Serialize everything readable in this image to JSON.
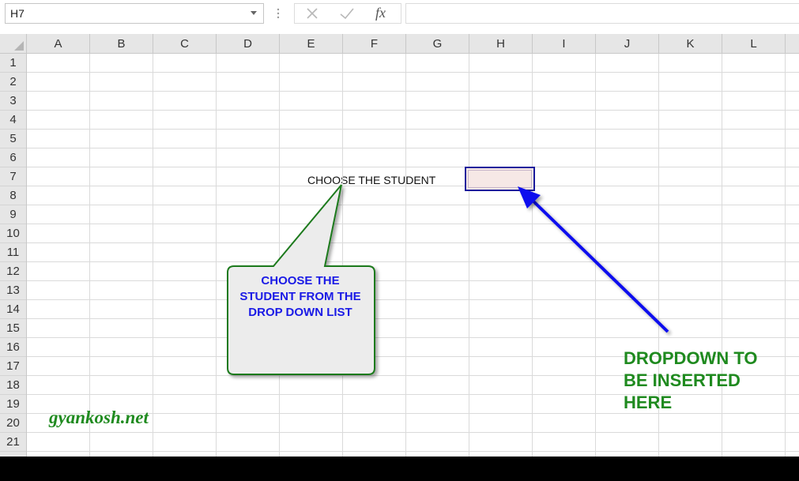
{
  "formula_bar": {
    "name_box": "H7",
    "formula": ""
  },
  "columns": [
    "A",
    "B",
    "C",
    "D",
    "E",
    "F",
    "G",
    "H",
    "I",
    "J",
    "K",
    "L"
  ],
  "rows": [
    "1",
    "2",
    "3",
    "4",
    "5",
    "6",
    "7",
    "8",
    "9",
    "10",
    "11",
    "12",
    "13",
    "14",
    "15",
    "16",
    "17",
    "18",
    "19",
    "20",
    "21"
  ],
  "sheet": {
    "e7_text": "CHOOSE THE STUDENT",
    "h7_value": ""
  },
  "annotations": {
    "callout_text": "CHOOSE THE STUDENT FROM THE DROP DOWN LIST",
    "dropdown_note": "DROPDOWN TO BE INSERTED HERE",
    "watermark": "gyankosh.net"
  },
  "colors": {
    "callout_text": "#1a1ae6",
    "callout_border": "#1f7a1f",
    "arrow": "#1010ee",
    "note_text": "#1f8a1f",
    "selected_border": "#1a1a9c"
  }
}
